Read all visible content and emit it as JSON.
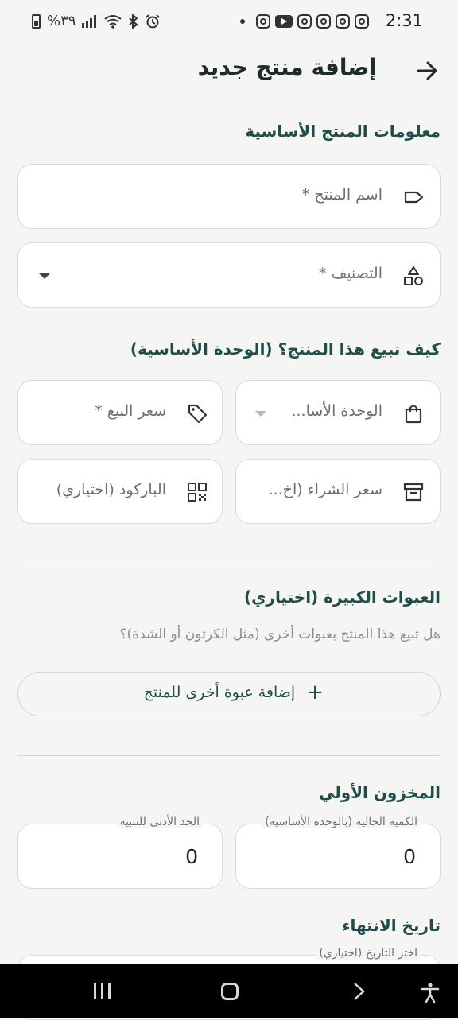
{
  "status_bar": {
    "time": "2:31",
    "battery": "%٣٩"
  },
  "header": {
    "title": "إضافة منتج جديد"
  },
  "basic_info": {
    "title": "معلومات المنتج الأساسية",
    "name_placeholder": "اسم المنتج *",
    "category_placeholder": "التصنيف *"
  },
  "selling": {
    "title": "كيف تبيع هذا المنتج؟ (الوحدة الأساسية)",
    "base_unit_placeholder": "الوحدة الأسا...",
    "sale_price_placeholder": "سعر البيع *",
    "purchase_price_placeholder": "سعر الشراء (اخ...",
    "barcode_placeholder": "الباركود (اختياري)"
  },
  "packages": {
    "title": "العبوات الكبيرة (اختياري)",
    "help": "هل تبيع هذا المنتج بعبوات أخرى (مثل الكرتون أو الشدة)؟",
    "add_button": "إضافة عبوة أخرى للمنتج"
  },
  "stock": {
    "title": "المخزون الأولي",
    "current_qty_label": "الكمية الحالية (بالوحدة الأساسية)",
    "current_qty_value": "0",
    "min_alert_label": "الحد الأدنى للتنبيه",
    "min_alert_value": "0"
  },
  "expiry": {
    "title": "تاريخ الانتهاء",
    "date_label": "اختر التاريخ (اختياري)"
  },
  "colors": {
    "accent": "#1f4d4a",
    "background": "#f5f5f4"
  }
}
